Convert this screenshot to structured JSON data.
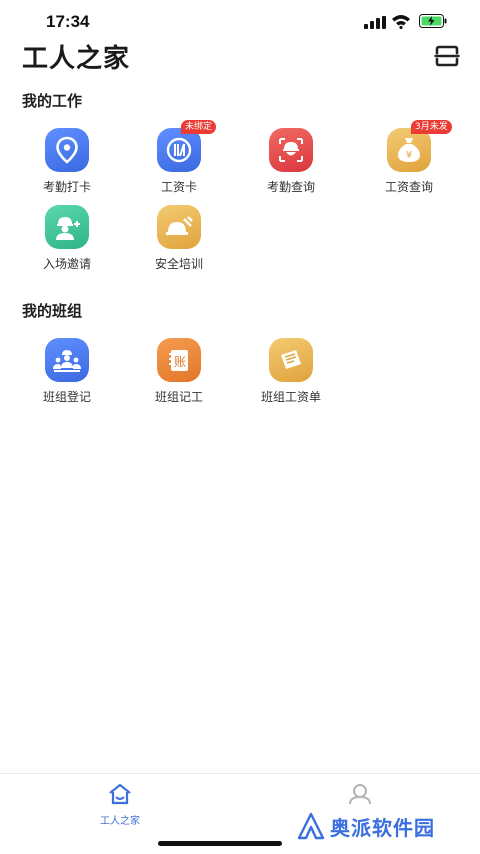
{
  "status": {
    "time": "17:34"
  },
  "header": {
    "title": "工人之家"
  },
  "colors": {
    "blue": "#4a7df0",
    "orange": "#f08a2e",
    "red": "#e5484d",
    "gold": "#e9b54a",
    "green": "#3fc49a",
    "badge": "#ea3b35",
    "tab_active": "#3f6fd8",
    "tab_inactive": "#b5b5b5"
  },
  "my_work": {
    "title": "我的工作",
    "items": [
      {
        "label": "考勤打卡",
        "icon": "location-pin-icon"
      },
      {
        "label": "工资卡",
        "icon": "bank-card-icon",
        "badge": "未绑定"
      },
      {
        "label": "考勤查询",
        "icon": "hardhat-face-icon"
      },
      {
        "label": "工资查询",
        "icon": "money-bag-icon",
        "badge": "3月未发"
      },
      {
        "label": "入场邀请",
        "icon": "worker-invite-icon"
      },
      {
        "label": "安全培训",
        "icon": "helmet-tools-icon"
      }
    ]
  },
  "my_team": {
    "title": "我的班组",
    "items": [
      {
        "label": "班组登记",
        "icon": "team-group-icon"
      },
      {
        "label": "班组记工",
        "icon": "ledger-book-icon",
        "glyph": "账"
      },
      {
        "label": "班组工资单",
        "icon": "payroll-sheet-icon"
      }
    ]
  },
  "tabbar": {
    "tabs": [
      {
        "label": "工人之家",
        "icon": "home-icon",
        "active": true
      },
      {
        "label": "",
        "icon": "profile-icon",
        "active": false
      }
    ]
  },
  "watermark": {
    "text": "奥派软件园"
  }
}
